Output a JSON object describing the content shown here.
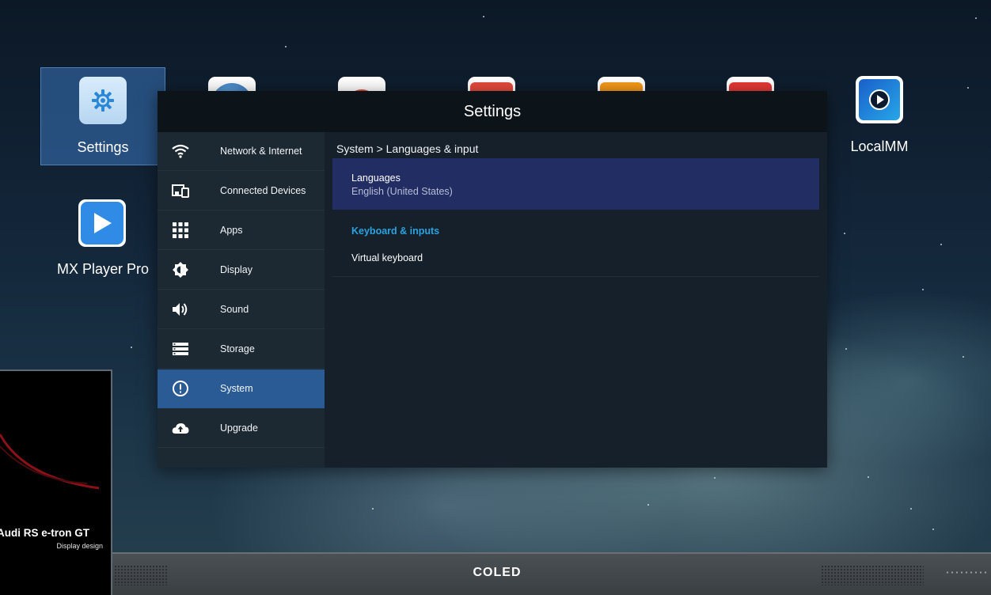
{
  "desktop": {
    "apps": [
      {
        "label": "Settings",
        "icon": "gear-icon"
      },
      {
        "label": "MX Player Pro",
        "icon": "play-icon"
      },
      {
        "label": "LocalMM",
        "icon": "media-play-icon"
      },
      {
        "label": "",
        "icon": "globe-icon"
      },
      {
        "label": "",
        "icon": "app-icon"
      },
      {
        "label": "",
        "icon": "app-icon"
      },
      {
        "label": "",
        "icon": "app-icon"
      },
      {
        "label": "",
        "icon": "cast-icon"
      }
    ]
  },
  "settings": {
    "title": "Settings",
    "nav": [
      {
        "label": "Network & Internet",
        "icon": "wifi-icon"
      },
      {
        "label": "Connected Devices",
        "icon": "devices-icon"
      },
      {
        "label": "Apps",
        "icon": "apps-grid-icon"
      },
      {
        "label": "Display",
        "icon": "brightness-icon"
      },
      {
        "label": "Sound",
        "icon": "speaker-icon"
      },
      {
        "label": "Storage",
        "icon": "storage-icon"
      },
      {
        "label": "System",
        "icon": "info-icon"
      },
      {
        "label": "Upgrade",
        "icon": "cloud-upload-icon"
      }
    ],
    "active_nav": "System",
    "breadcrumb": "System > Languages & input",
    "languages": {
      "title": "Languages",
      "value": "English (United States)"
    },
    "section_header": "Keyboard & inputs",
    "virtual_keyboard": "Virtual keyboard"
  },
  "promo": {
    "title": "Audi RS e-tron GT",
    "subtitle": "Display design"
  },
  "bezel": {
    "brand": "COLED"
  },
  "colors": {
    "active_nav": "#2a5b94",
    "selected_row": "#222d63",
    "section_accent": "#29a3e0"
  }
}
